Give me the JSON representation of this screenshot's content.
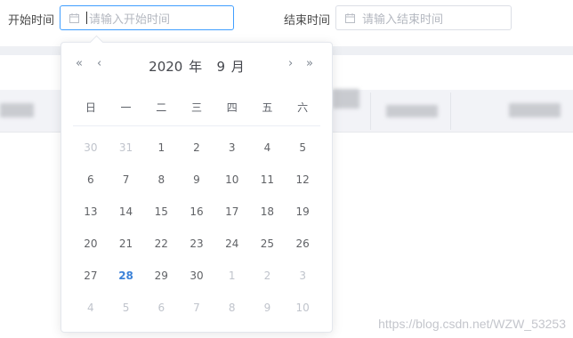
{
  "filter": {
    "start_label": "开始时间",
    "start_placeholder": "请输入开始时间",
    "end_label": "结束时间",
    "end_placeholder": "请输入结束时间"
  },
  "calendar": {
    "year": "2020",
    "year_unit": "年",
    "month": "9",
    "month_unit": "月",
    "prev_year": "«",
    "prev_month": "‹",
    "next_month": "›",
    "next_year": "»",
    "weekdays": [
      "日",
      "一",
      "二",
      "三",
      "四",
      "五",
      "六"
    ],
    "days": [
      {
        "d": "30",
        "other": true
      },
      {
        "d": "31",
        "other": true
      },
      {
        "d": "1"
      },
      {
        "d": "2"
      },
      {
        "d": "3"
      },
      {
        "d": "4"
      },
      {
        "d": "5"
      },
      {
        "d": "6"
      },
      {
        "d": "7"
      },
      {
        "d": "8"
      },
      {
        "d": "9"
      },
      {
        "d": "10"
      },
      {
        "d": "11"
      },
      {
        "d": "12"
      },
      {
        "d": "13"
      },
      {
        "d": "14"
      },
      {
        "d": "15"
      },
      {
        "d": "16"
      },
      {
        "d": "17"
      },
      {
        "d": "18"
      },
      {
        "d": "19"
      },
      {
        "d": "20"
      },
      {
        "d": "21"
      },
      {
        "d": "22"
      },
      {
        "d": "23"
      },
      {
        "d": "24"
      },
      {
        "d": "25"
      },
      {
        "d": "26"
      },
      {
        "d": "27"
      },
      {
        "d": "28",
        "today": true
      },
      {
        "d": "29"
      },
      {
        "d": "30"
      },
      {
        "d": "1",
        "other": true
      },
      {
        "d": "2",
        "other": true
      },
      {
        "d": "3",
        "other": true
      },
      {
        "d": "4",
        "other": true
      },
      {
        "d": "5",
        "other": true
      },
      {
        "d": "6",
        "other": true
      },
      {
        "d": "7",
        "other": true
      },
      {
        "d": "8",
        "other": true
      },
      {
        "d": "9",
        "other": true
      },
      {
        "d": "10",
        "other": true
      }
    ]
  },
  "icons": {
    "input": "calendar-icon"
  },
  "colors": {
    "accent": "#409eff",
    "today": "#3c82d8",
    "muted": "#c0c4cc"
  },
  "watermark": "https://blog.csdn.net/WZW_53253"
}
